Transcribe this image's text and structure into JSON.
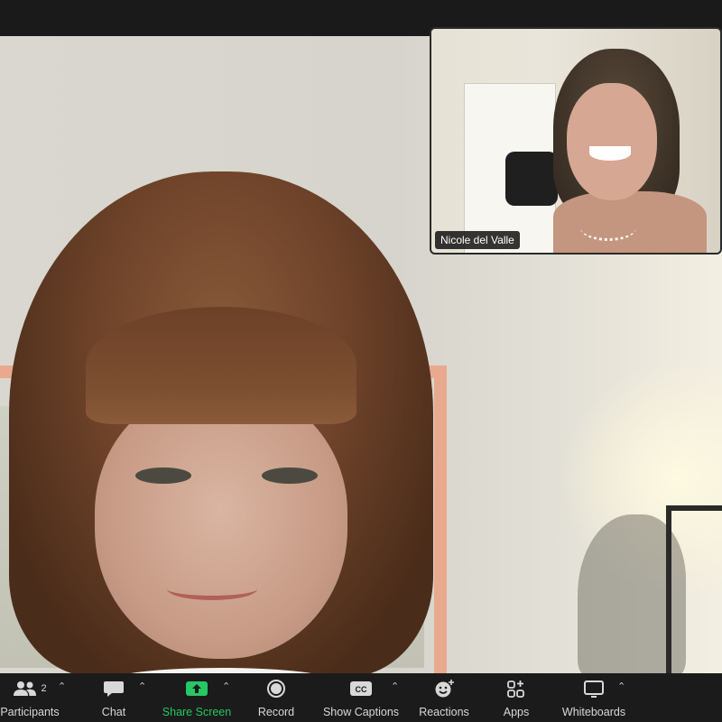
{
  "main_video": {
    "participant": "main-participant-video"
  },
  "thumbnail": {
    "name": "Nicole del Valle"
  },
  "toolbar": {
    "participants": {
      "label": "Participants",
      "count": "2",
      "icon": "participants-icon"
    },
    "chat": {
      "label": "Chat",
      "icon": "chat-icon"
    },
    "share_screen": {
      "label": "Share Screen",
      "icon": "share-screen-icon"
    },
    "record": {
      "label": "Record",
      "icon": "record-icon"
    },
    "captions": {
      "label": "Show Captions",
      "icon_text": "CC",
      "icon": "captions-icon"
    },
    "reactions": {
      "label": "Reactions",
      "icon": "reactions-icon"
    },
    "apps": {
      "label": "Apps",
      "icon": "apps-icon"
    },
    "whiteboards": {
      "label": "Whiteboards",
      "icon": "whiteboard-icon"
    }
  },
  "colors": {
    "toolbar_bg": "#1b1b1b",
    "share_green": "#26c764",
    "label_gray": "#d8d8d8"
  }
}
